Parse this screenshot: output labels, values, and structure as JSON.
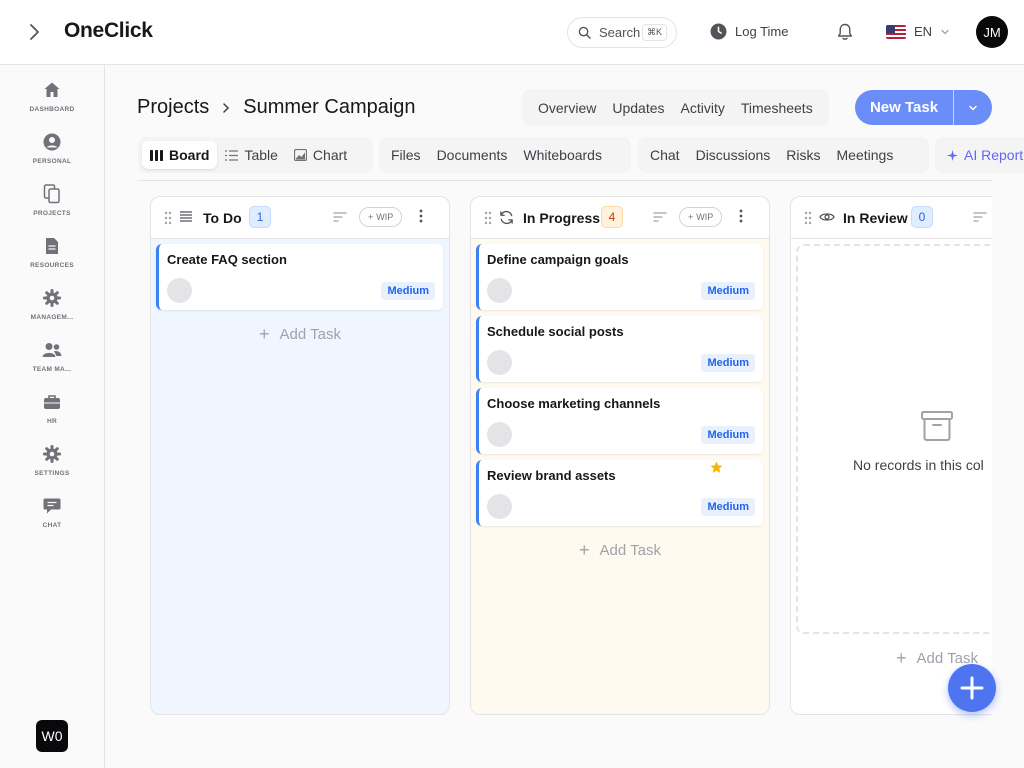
{
  "app": {
    "title": "OneClick"
  },
  "topbar": {
    "search_label": "Search",
    "search_shortcut": "⌘K",
    "log_time": "Log Time",
    "language": "EN",
    "user_initials": "JM"
  },
  "sidebar": {
    "items": [
      {
        "label": "DASHBOARD",
        "icon": "home-icon"
      },
      {
        "label": "PERSONAL",
        "icon": "user-icon"
      },
      {
        "label": "PROJECTS",
        "icon": "projects-icon"
      },
      {
        "label": "RESOURCES",
        "icon": "document-icon"
      },
      {
        "label": "MANAGEM...",
        "icon": "gear-icon"
      },
      {
        "label": "TEAM MA...",
        "icon": "team-icon"
      },
      {
        "label": "HR",
        "icon": "briefcase-icon"
      },
      {
        "label": "SETTINGS",
        "icon": "gear-icon"
      },
      {
        "label": "CHAT",
        "icon": "chat-icon"
      }
    ],
    "workspace": "W0"
  },
  "page": {
    "breadcrumb_root": "Projects",
    "breadcrumb_current": "Summer Campaign",
    "nav": [
      "Overview",
      "Updates",
      "Activity",
      "Timesheets"
    ],
    "new_task": "New Task"
  },
  "tabs": {
    "views": [
      "Board",
      "Table",
      "Chart"
    ],
    "content": [
      "Files",
      "Documents",
      "Whiteboards"
    ],
    "collab": [
      "Chat",
      "Discussions",
      "Risks",
      "Meetings"
    ],
    "ai": "AI Report"
  },
  "columns": [
    {
      "title": "To Do",
      "count": "1",
      "wip": "WIP",
      "bg": "#f0f6ff",
      "cards": [
        {
          "title": "Create FAQ section",
          "priority": "Medium",
          "starred": false
        }
      ],
      "add_task": "Add Task"
    },
    {
      "title": "In Progress",
      "count": "4",
      "wip": "WIP",
      "bg": "#fffaf0",
      "cards": [
        {
          "title": "Define campaign goals",
          "priority": "Medium",
          "starred": false
        },
        {
          "title": "Schedule social posts",
          "priority": "Medium",
          "starred": false
        },
        {
          "title": "Choose marketing channels",
          "priority": "Medium",
          "starred": false
        },
        {
          "title": "Review brand assets",
          "priority": "Medium",
          "starred": true
        }
      ],
      "add_task": "Add Task"
    },
    {
      "title": "In Review",
      "count": "0",
      "bg": "#ffffff",
      "empty_text": "No records in this col",
      "add_task": "Add Task"
    }
  ],
  "colors": {
    "accent": "#6b8df7",
    "fab": "#4f74f0",
    "card_border": "#3b82f6",
    "priority_text": "#2563eb",
    "star": "#f5b800"
  }
}
